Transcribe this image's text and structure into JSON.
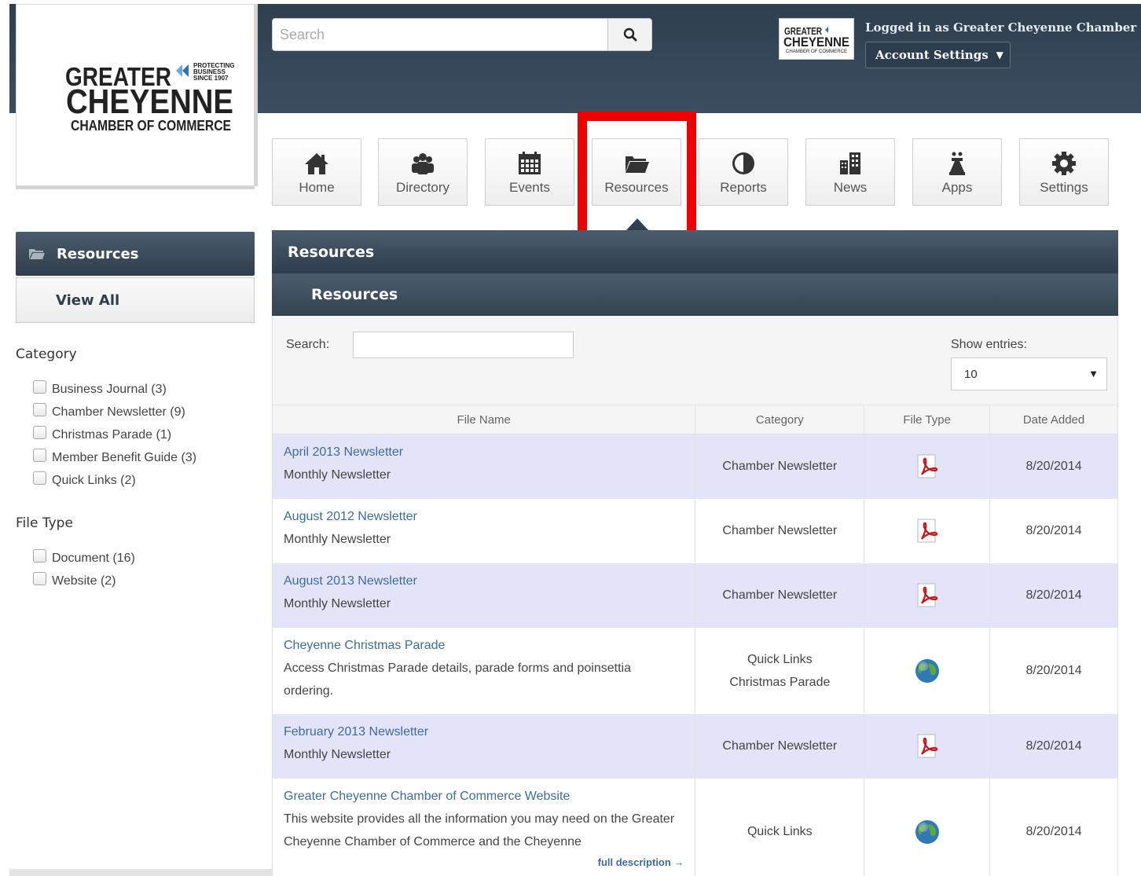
{
  "header": {
    "search_placeholder": "Search",
    "logged_in_text": "Logged in as Greater Cheyenne Chamber o",
    "account_settings_label": "Account Settings"
  },
  "logo": {
    "line1": "GREATER",
    "line2": "CHEYENNE",
    "line3": "CHAMBER OF COMMERCE",
    "tag1": "PROTECTING",
    "tag2": "BUSINESS",
    "tag3": "SINCE 1907"
  },
  "nav": {
    "items": [
      {
        "label": "Home",
        "icon": "home-icon"
      },
      {
        "label": "Directory",
        "icon": "people-icon"
      },
      {
        "label": "Events",
        "icon": "calendar-icon"
      },
      {
        "label": "Resources",
        "icon": "folder-icon"
      },
      {
        "label": "Reports",
        "icon": "pie-chart-icon"
      },
      {
        "label": "News",
        "icon": "building-icon"
      },
      {
        "label": "Apps",
        "icon": "chess-piece-icon"
      },
      {
        "label": "Settings",
        "icon": "gear-icon"
      }
    ],
    "highlight_color": "#ee0000"
  },
  "sidebar": {
    "heading": "Resources",
    "view_all": "View All",
    "category_title": "Category",
    "categories": [
      "Business Journal (3)",
      "Chamber Newsletter (9)",
      "Christmas Parade (1)",
      "Member Benefit Guide (3)",
      "Quick Links (2)"
    ],
    "filetype_title": "File Type",
    "filetypes": [
      "Document (16)",
      "Website (2)"
    ]
  },
  "main": {
    "title": "Resources",
    "subtitle": "Resources",
    "search_label": "Search:",
    "entries_label": "Show entries:",
    "entries_value": "10",
    "columns": [
      "File Name",
      "Category",
      "File Type",
      "Date Added"
    ],
    "rows": [
      {
        "title": "April 2013 Newsletter",
        "desc": "Monthly Newsletter",
        "cat1": "Chamber Newsletter",
        "cat2": "",
        "type": "pdf-icon",
        "date": "8/20/2014"
      },
      {
        "title": "August 2012 Newsletter",
        "desc": "Monthly Newsletter",
        "cat1": "Chamber Newsletter",
        "cat2": "",
        "type": "pdf-icon",
        "date": "8/20/2014"
      },
      {
        "title": "August 2013 Newsletter",
        "desc": "Monthly Newsletter",
        "cat1": "Chamber Newsletter",
        "cat2": "",
        "type": "pdf-icon",
        "date": "8/20/2014"
      },
      {
        "title": "Cheyenne Christmas Parade",
        "desc": "Access Christmas Parade details, parade forms and poinsettia ordering.",
        "cat1": "Quick Links",
        "cat2": "Christmas Parade",
        "type": "globe-icon",
        "date": "8/20/2014"
      },
      {
        "title": "February 2013 Newsletter",
        "desc": "Monthly Newsletter",
        "cat1": "Chamber Newsletter",
        "cat2": "",
        "type": "pdf-icon",
        "date": "8/20/2014"
      },
      {
        "title": "Greater Cheyenne Chamber of Commerce Website",
        "desc": "This website provides all the information you may need on the Greater Cheyenne Chamber of Commerce and the Cheyenne",
        "cat1": "Quick Links",
        "cat2": "",
        "type": "globe-icon",
        "date": "8/20/2014",
        "more": "full description →"
      }
    ]
  }
}
